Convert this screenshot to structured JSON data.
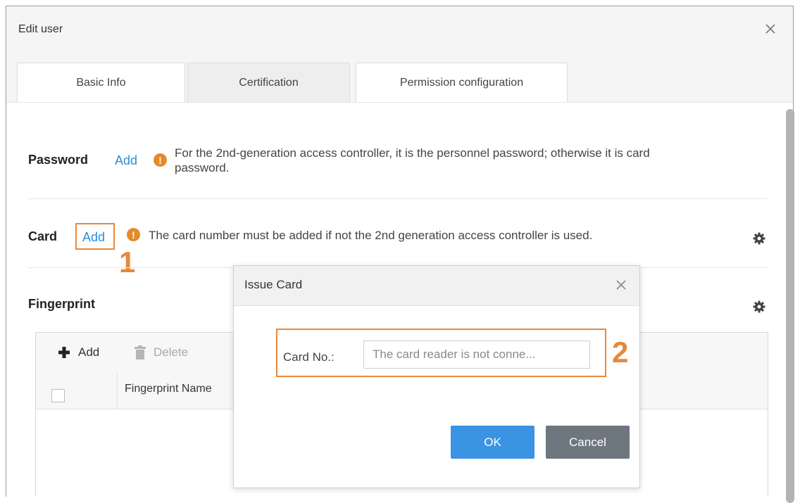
{
  "window": {
    "title": "Edit user"
  },
  "tabs": [
    {
      "label": "Basic Info"
    },
    {
      "label": "Certification"
    },
    {
      "label": "Permission configuration"
    }
  ],
  "password": {
    "label": "Password",
    "add": "Add",
    "hint_line1": "For the 2nd-generation access controller, it is the personnel password; otherwise it is card",
    "hint_line2": "password."
  },
  "card": {
    "label": "Card",
    "add": "Add",
    "hint": "The card number must be added if not the 2nd generation access controller is used.",
    "step": "1"
  },
  "fingerprint": {
    "label": "Fingerprint",
    "toolbar": {
      "add": "Add",
      "delete": "Delete"
    },
    "columns": [
      "Fingerprint Name"
    ]
  },
  "issue_card_dialog": {
    "title": "Issue Card",
    "card_no_label": "Card No.:",
    "card_no_placeholder": "The card reader is not conne...",
    "step": "2",
    "ok": "OK",
    "cancel": "Cancel"
  },
  "colors": {
    "accent": "#3b93e4",
    "link": "#2d8ed8",
    "highlight": "#e8883a",
    "warning": "#e48a2a"
  }
}
